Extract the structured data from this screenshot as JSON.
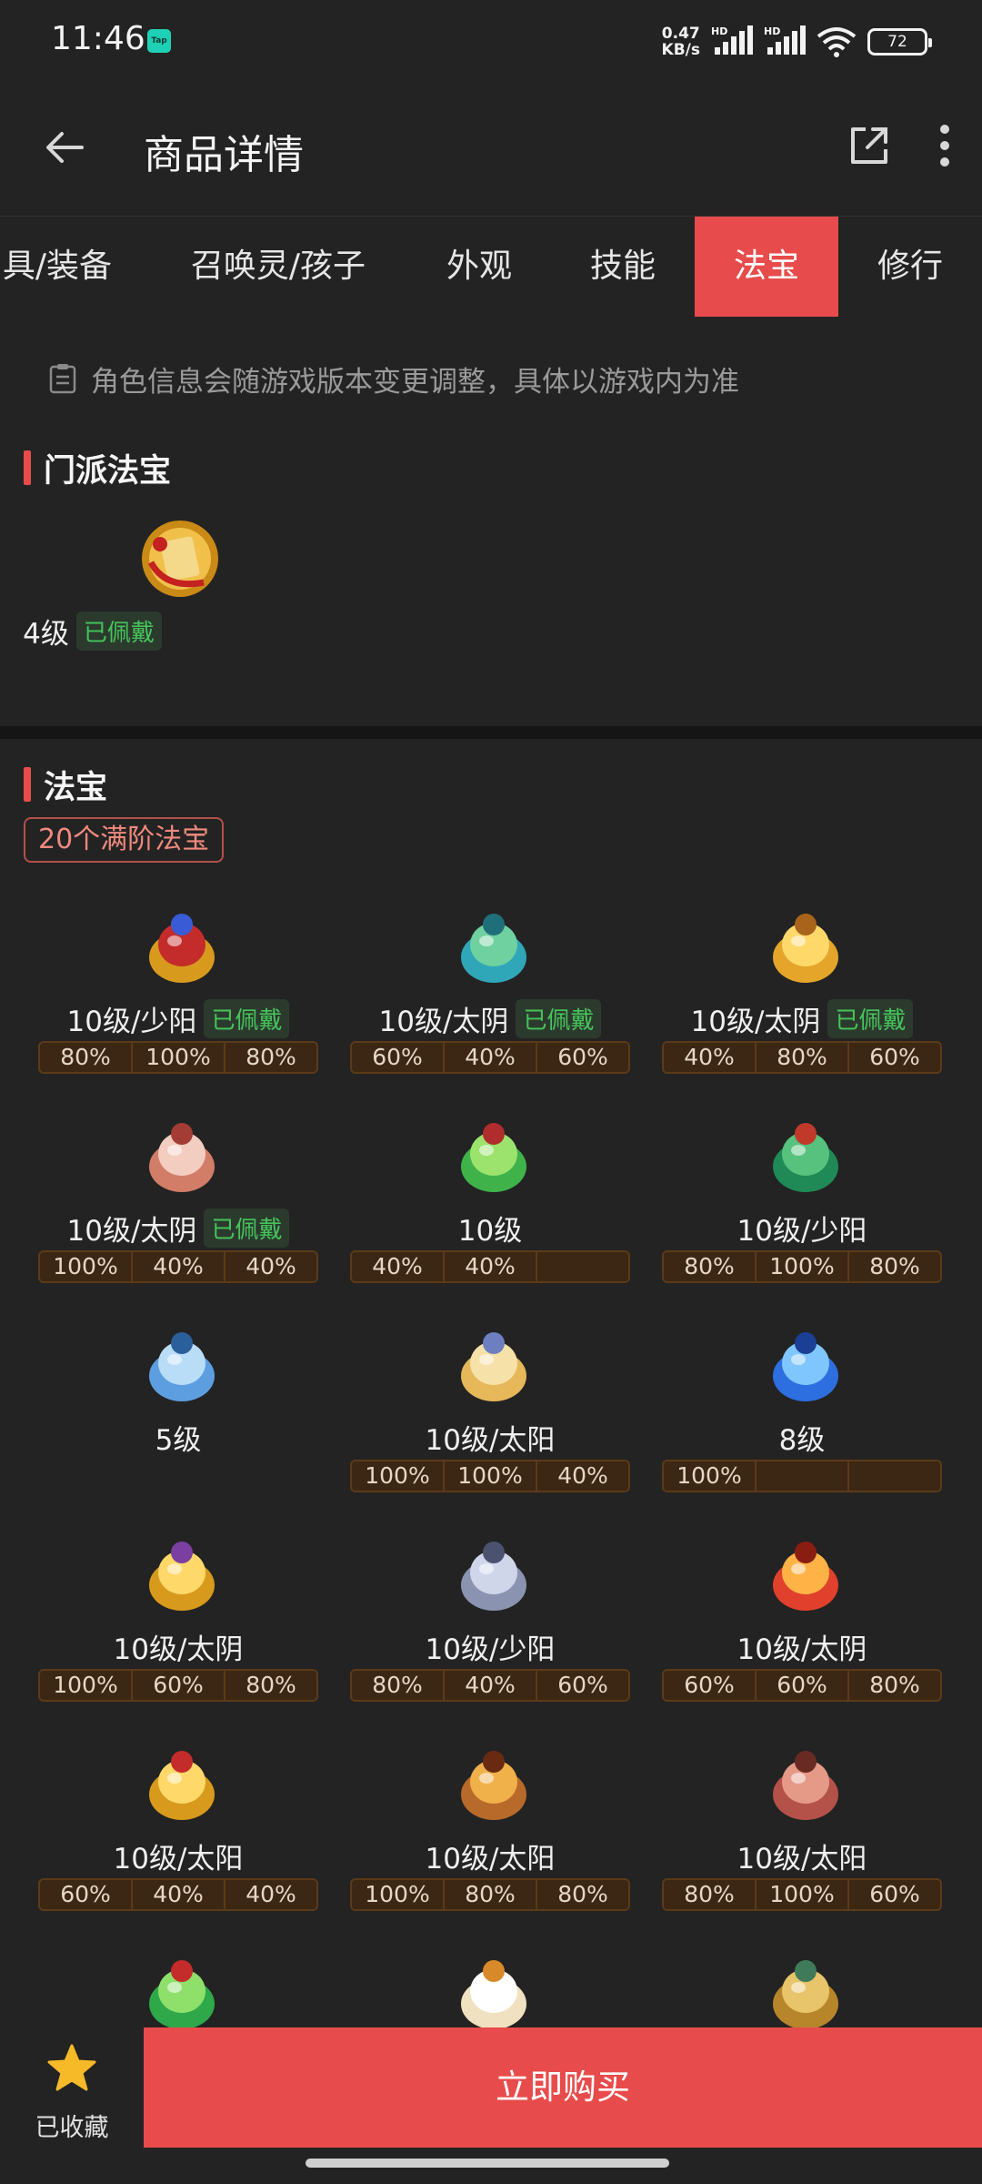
{
  "status": {
    "time": "11:46",
    "app_badge": "Tap",
    "speed_value": "0.47",
    "speed_unit": "KB/s",
    "battery": "72",
    "hd1": "HD",
    "hd2": "HD"
  },
  "header": {
    "title": "商品详情"
  },
  "tabs": [
    {
      "label": "具/装备",
      "active": false
    },
    {
      "label": "召唤灵/孩子",
      "active": false
    },
    {
      "label": "外观",
      "active": false
    },
    {
      "label": "技能",
      "active": false
    },
    {
      "label": "法宝",
      "active": true
    },
    {
      "label": "修行",
      "active": false
    }
  ],
  "notice": "角色信息会随游戏版本变更调整，具体以游戏内为准",
  "sect": {
    "title": "门派法宝",
    "item": {
      "level": "4级",
      "equipped_label": "已佩戴",
      "icon": "scroll-treasure-icon"
    }
  },
  "treasures": {
    "title": "法宝",
    "count_badge": "20个满阶法宝",
    "equipped_label": "已佩戴",
    "items": [
      {
        "level": "10级/少阳",
        "equipped": true,
        "bars": [
          "80%",
          "100%",
          "80%"
        ],
        "icon": "crown-treasure-icon"
      },
      {
        "level": "10级/太阴",
        "equipped": true,
        "bars": [
          "60%",
          "40%",
          "60%"
        ],
        "icon": "jade-statue-icon"
      },
      {
        "level": "10级/太阴",
        "equipped": true,
        "bars": [
          "40%",
          "80%",
          "60%"
        ],
        "icon": "gold-gourd-icon"
      },
      {
        "level": "10级/太阴",
        "equipped": true,
        "bars": [
          "100%",
          "40%",
          "40%"
        ],
        "icon": "orb-mirror-icon"
      },
      {
        "level": "10级",
        "equipped": false,
        "bars": [
          "40%",
          "40%",
          ""
        ],
        "icon": "green-gourd-icon"
      },
      {
        "level": "10级/少阳",
        "equipped": false,
        "bars": [
          "80%",
          "100%",
          "80%"
        ],
        "icon": "umbrella-icon"
      },
      {
        "level": "5级",
        "equipped": false,
        "bars": [],
        "icon": "blue-book-icon"
      },
      {
        "level": "10级/太阳",
        "equipped": false,
        "bars": [
          "100%",
          "100%",
          "40%"
        ],
        "icon": "open-book-icon"
      },
      {
        "level": "8级",
        "equipped": false,
        "bars": [
          "100%",
          "",
          ""
        ],
        "icon": "blue-gem-icon"
      },
      {
        "level": "10级/太阴",
        "equipped": false,
        "bars": [
          "100%",
          "60%",
          "80%"
        ],
        "icon": "gold-ring-icon"
      },
      {
        "level": "10级/少阳",
        "equipped": false,
        "bars": [
          "80%",
          "40%",
          "60%"
        ],
        "icon": "stone-lantern-icon"
      },
      {
        "level": "10级/太阴",
        "equipped": false,
        "bars": [
          "60%",
          "60%",
          "80%"
        ],
        "icon": "flame-sword-icon"
      },
      {
        "level": "10级/太阳",
        "equipped": false,
        "bars": [
          "60%",
          "40%",
          "40%"
        ],
        "icon": "gold-pagoda-icon"
      },
      {
        "level": "10级/太阳",
        "equipped": false,
        "bars": [
          "100%",
          "80%",
          "80%"
        ],
        "icon": "demon-mask-icon"
      },
      {
        "level": "10级/太阳",
        "equipped": false,
        "bars": [
          "80%",
          "100%",
          "60%"
        ],
        "icon": "red-seal-icon"
      },
      {
        "level": "",
        "equipped": false,
        "bars": [],
        "icon": "green-dragon-icon"
      },
      {
        "level": "",
        "equipped": false,
        "bars": [],
        "icon": "ghost-hood-icon"
      },
      {
        "level": "",
        "equipped": false,
        "bars": [],
        "icon": "bronze-medallion-icon"
      }
    ]
  },
  "bottom": {
    "favorite_label": "已收藏",
    "buy_label": "立即购买"
  },
  "colors": {
    "accent": "#e84b4b",
    "equipped_green": "#45c45a",
    "bar_bg": "#3b2714"
  }
}
